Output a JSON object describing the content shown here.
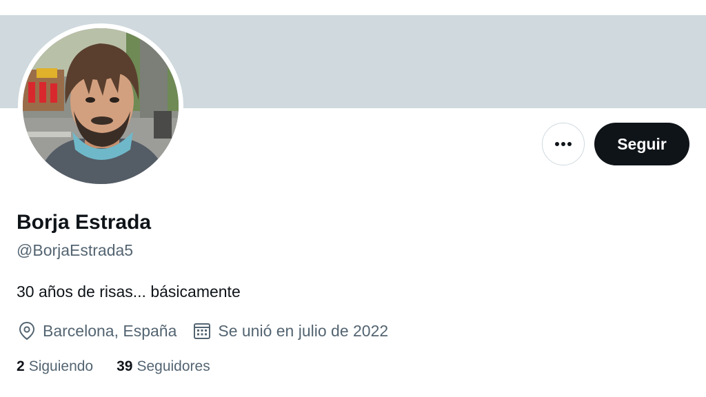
{
  "profile": {
    "display_name": "Borja Estrada",
    "handle": "@BorjaEstrada5",
    "bio": "30 años de risas... básicamente",
    "location": "Barcelona, España",
    "joined": "Se unió en julio de 2022"
  },
  "actions": {
    "more_icon": "more-horizontal-icon",
    "follow_label": "Seguir"
  },
  "stats": {
    "following_count": "2",
    "following_label": "Siguiendo",
    "followers_count": "39",
    "followers_label": "Seguidores"
  },
  "icons": {
    "location": "location-pin-icon",
    "joined": "calendar-icon"
  },
  "colors": {
    "banner": "#cfd9de",
    "primary_text": "#0f1419",
    "secondary_text": "#536471",
    "follow_button_bg": "#0f1419"
  }
}
